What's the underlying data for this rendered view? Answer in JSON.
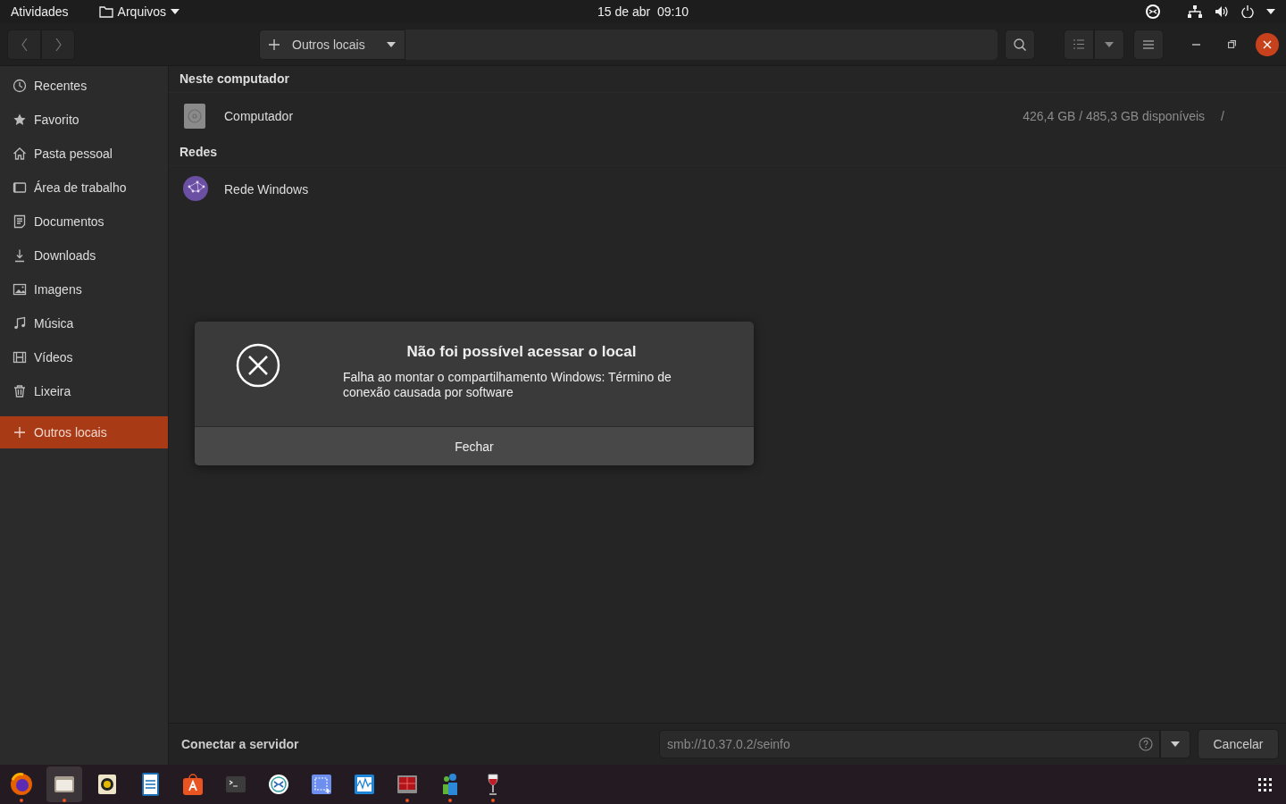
{
  "top_bar": {
    "activities": "Atividades",
    "app_menu": "Arquivos",
    "clock": "15 de abr  09:10"
  },
  "header": {
    "nav_buttons": [
      {
        "kind": "back",
        "disabled": true
      },
      {
        "kind": "forward",
        "disabled": true
      }
    ],
    "path_button": "Outros locais"
  },
  "sidebar": {
    "items": [
      {
        "label": "Recentes",
        "selected": false
      },
      {
        "label": "Favorito",
        "selected": false
      },
      {
        "label": "Pasta pessoal",
        "selected": false
      },
      {
        "label": "Área de trabalho",
        "selected": false
      },
      {
        "label": "Documentos",
        "selected": false
      },
      {
        "label": "Downloads",
        "selected": false
      },
      {
        "label": "Imagens",
        "selected": false
      },
      {
        "label": "Música",
        "selected": false
      },
      {
        "label": "Vídeos",
        "selected": false
      },
      {
        "label": "Lixeira",
        "selected": false
      },
      {
        "label": "Outros locais",
        "selected": true
      }
    ]
  },
  "places": {
    "sections": [
      {
        "title": "Neste computador",
        "items": [
          {
            "name": "Computador",
            "usage": "426,4 GB / 485,3 GB disponíveis",
            "mount": "/"
          }
        ]
      },
      {
        "title": "Redes",
        "items": [
          {
            "name": "Rede Windows"
          }
        ]
      }
    ]
  },
  "connect_bar": {
    "label": "Conectar a servidor",
    "value": "smb://10.37.0.2/seinfo",
    "cancel": "Cancelar"
  },
  "dialog": {
    "title": "Não foi possível acessar o local",
    "message": "Falha ao montar o compartilhamento Windows: Término de conexão causada por software",
    "button": "Fechar"
  },
  "dock": {
    "apps": [
      {
        "kind": "firefox",
        "running": true,
        "selected": false
      },
      {
        "kind": "files",
        "running": true,
        "selected": true
      },
      {
        "kind": "speaker",
        "running": false,
        "selected": false
      },
      {
        "kind": "writer",
        "running": false,
        "selected": false
      },
      {
        "kind": "store",
        "running": false,
        "selected": false
      },
      {
        "kind": "terminal",
        "running": false,
        "selected": false
      },
      {
        "kind": "remote",
        "running": false,
        "selected": false
      },
      {
        "kind": "screenshot",
        "running": false,
        "selected": false
      },
      {
        "kind": "monitor",
        "running": false,
        "selected": false
      },
      {
        "kind": "grid",
        "running": true,
        "selected": false
      },
      {
        "kind": "people",
        "running": true,
        "selected": false
      },
      {
        "kind": "wine",
        "running": true,
        "selected": false
      }
    ]
  }
}
